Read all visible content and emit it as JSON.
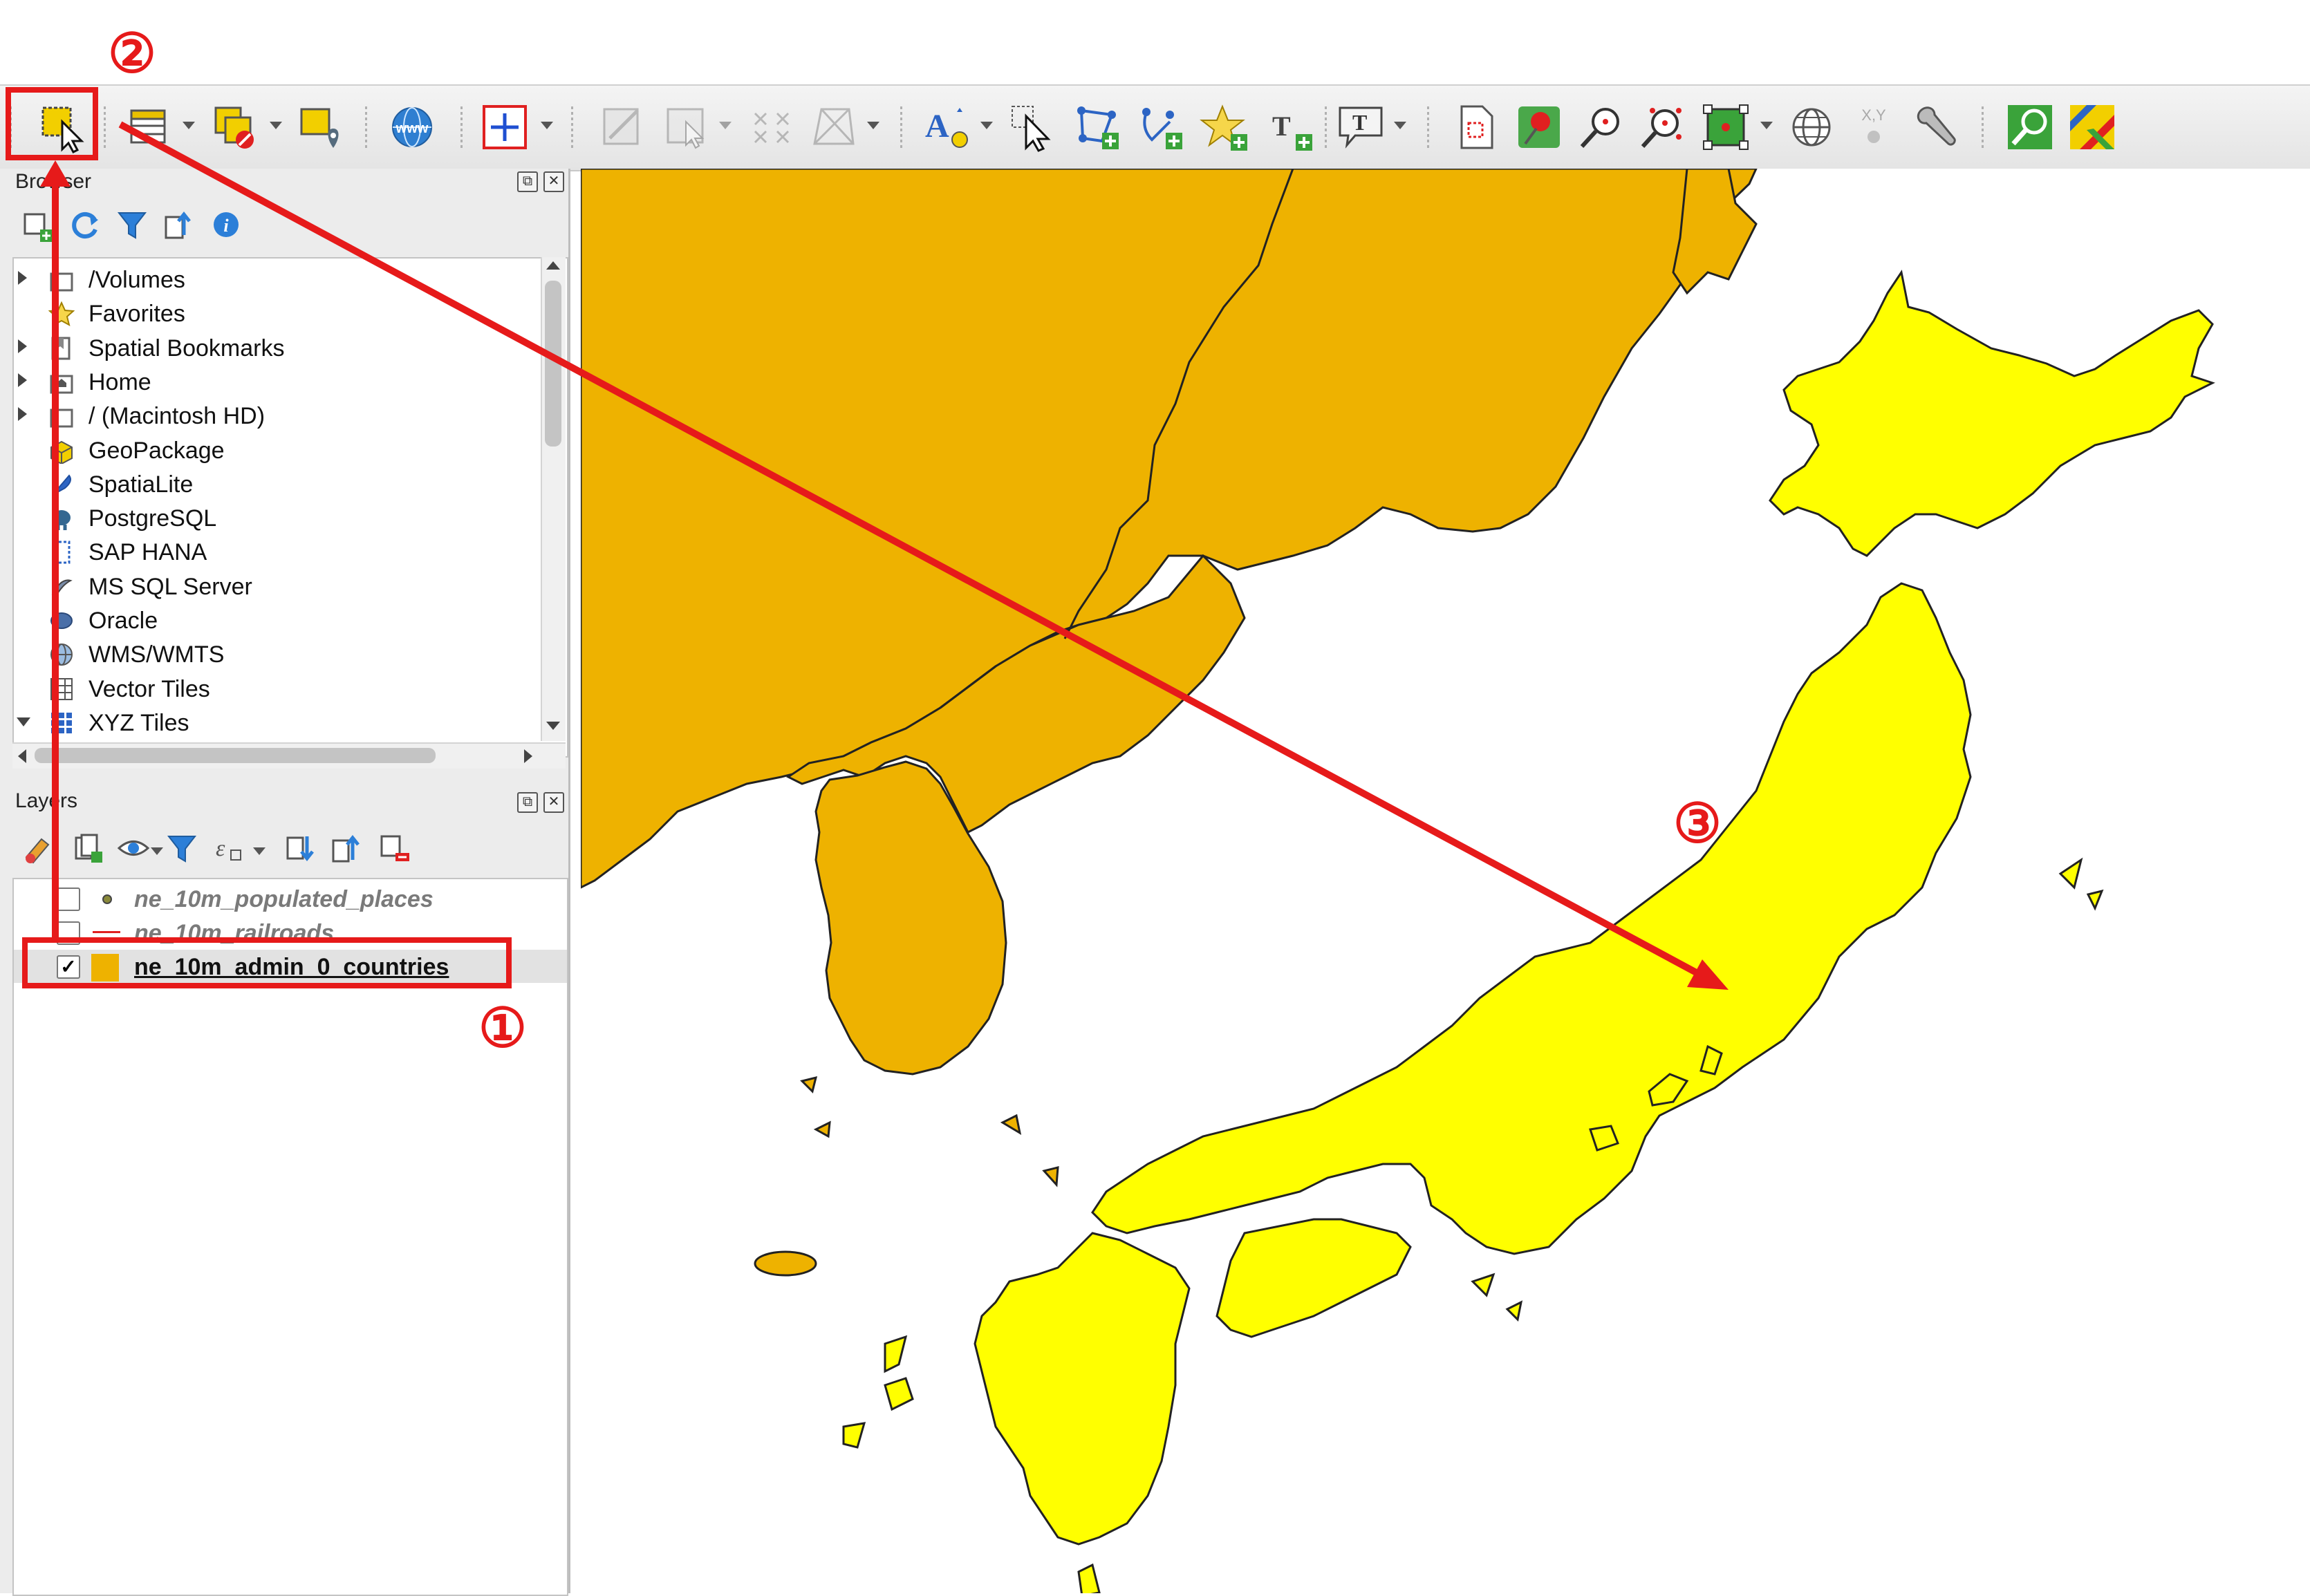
{
  "toolbar": {
    "buttons": [
      {
        "name": "select-features-icon"
      },
      {
        "name": "attribute-table-icon"
      },
      {
        "name": "deselect-features-icon"
      },
      {
        "name": "select-location-icon"
      },
      {
        "name": "wms-icon"
      },
      {
        "name": "add-feature-icon"
      },
      {
        "name": "digitize-icon"
      },
      {
        "name": "vertex-tool-icon"
      },
      {
        "name": "reshape-icon"
      },
      {
        "name": "split-icon"
      },
      {
        "name": "label-tool-icon"
      },
      {
        "name": "pointer-icon"
      },
      {
        "name": "add-polygon-icon"
      },
      {
        "name": "add-line-icon"
      },
      {
        "name": "add-point-icon"
      },
      {
        "name": "text-annotation-icon"
      },
      {
        "name": "annotation-icon"
      },
      {
        "name": "new-layout-icon"
      },
      {
        "name": "pin-icon"
      },
      {
        "name": "zoom-in-icon"
      },
      {
        "name": "zoom-selection-icon"
      },
      {
        "name": "zoom-extent-icon"
      },
      {
        "name": "globe-icon"
      },
      {
        "name": "xy-coordinate-icon"
      },
      {
        "name": "wrench-icon"
      },
      {
        "name": "locator-icon"
      },
      {
        "name": "map-style-icon"
      }
    ],
    "xy_label": "X,Y"
  },
  "browser": {
    "title": "Browser",
    "items": [
      {
        "label": "/Volumes",
        "icon": "folder-icon",
        "arrow": "right"
      },
      {
        "label": "Favorites",
        "icon": "star-icon",
        "arrow": ""
      },
      {
        "label": "Spatial Bookmarks",
        "icon": "bookmark-icon",
        "arrow": "right"
      },
      {
        "label": "Home",
        "icon": "home-folder-icon",
        "arrow": "right"
      },
      {
        "label": "/ (Macintosh HD)",
        "icon": "folder-icon",
        "arrow": "right"
      },
      {
        "label": "GeoPackage",
        "icon": "geopackage-icon",
        "arrow": ""
      },
      {
        "label": "SpatiaLite",
        "icon": "feather-icon",
        "arrow": ""
      },
      {
        "label": "PostgreSQL",
        "icon": "elephant-icon",
        "arrow": ""
      },
      {
        "label": "SAP HANA",
        "icon": "database-grid-icon",
        "arrow": ""
      },
      {
        "label": "MS SQL Server",
        "icon": "mssql-icon",
        "arrow": ""
      },
      {
        "label": "Oracle",
        "icon": "oracle-icon",
        "arrow": ""
      },
      {
        "label": "WMS/WMTS",
        "icon": "globe-icon",
        "arrow": ""
      },
      {
        "label": "Vector Tiles",
        "icon": "grid-icon",
        "arrow": ""
      },
      {
        "label": "XYZ Tiles",
        "icon": "tiles-icon",
        "arrow": "down"
      }
    ]
  },
  "layers": {
    "title": "Layers",
    "items": [
      {
        "label": "ne_10m_populated_places",
        "checked": false,
        "symbol": "point"
      },
      {
        "label": "ne_10m_railroads",
        "checked": false,
        "symbol": "line"
      },
      {
        "label": "ne_10m_admin_0_countries",
        "checked": true,
        "symbol": "polygon"
      }
    ],
    "selected_index": 2
  },
  "map": {
    "fill_other_countries": "#eeb200",
    "fill_selected_country": "#ffff00",
    "stroke": "#222222"
  },
  "annotations": {
    "step1": "①",
    "step2": "②",
    "step3": "③",
    "color": "#e61a1a"
  }
}
